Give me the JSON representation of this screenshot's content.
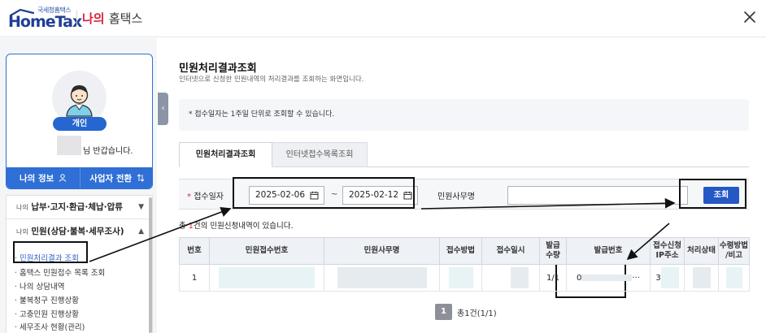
{
  "header": {
    "logo_small": "국세청홈택스",
    "logo_main": "HomeTax",
    "title_red": "나의",
    "title_dark": "홈택스"
  },
  "sidebar": {
    "badge": "개인",
    "greeting": "님 반갑습니다.",
    "my_info_button": "나의 정보",
    "switch_button": "사업자 전환",
    "menu": [
      {
        "prefix": "나의",
        "label": "납부·고지·환급·체납·압류"
      },
      {
        "prefix": "나의",
        "label": "민원(상담·불복·세무조사)"
      }
    ],
    "sub_items": [
      "민원처리결과 조회",
      "홈택스 민원접수 목록 조회",
      "나의 상담내역",
      "불복청구 진행상황",
      "고충민원 진행상황",
      "세무조사 현황(관리)"
    ]
  },
  "main": {
    "title": "민원처리결과조회",
    "description": "인터넷으로 신청한 민원내역의 처리결과를 조회하는 화면입니다.",
    "notice": "* 접수일자는 1주일 단위로 조회할 수 있습니다.",
    "tabs": [
      "민원처리결과조회",
      "인터넷접수목록조회"
    ],
    "search": {
      "date_label": "접수일자",
      "required_mark": "*",
      "date_from": "2025-02-06",
      "date_to": "2025-02-12",
      "tilde": "~",
      "office_label": "민원사무명",
      "office_value": "",
      "search_button": "조회"
    },
    "total": {
      "prefix": "총",
      "count": "1",
      "suffix": "건의 민원신청내역이 있습니다."
    },
    "table": {
      "headers": [
        "번호",
        "민원접수번호",
        "민원사무명",
        "접수방법",
        "접수일시",
        "발급\n수량",
        "발급번호",
        "접수신청\nIP주소",
        "처리상태",
        "수령방법\n/비고"
      ],
      "rows": [
        {
          "no": "1",
          "qty": "1/1",
          "issue_prefix": "0",
          "issue_suffix": "···",
          "ip_prefix": "3"
        }
      ]
    },
    "pagination": {
      "current": "1",
      "info": "총1건(1/1)"
    }
  }
}
